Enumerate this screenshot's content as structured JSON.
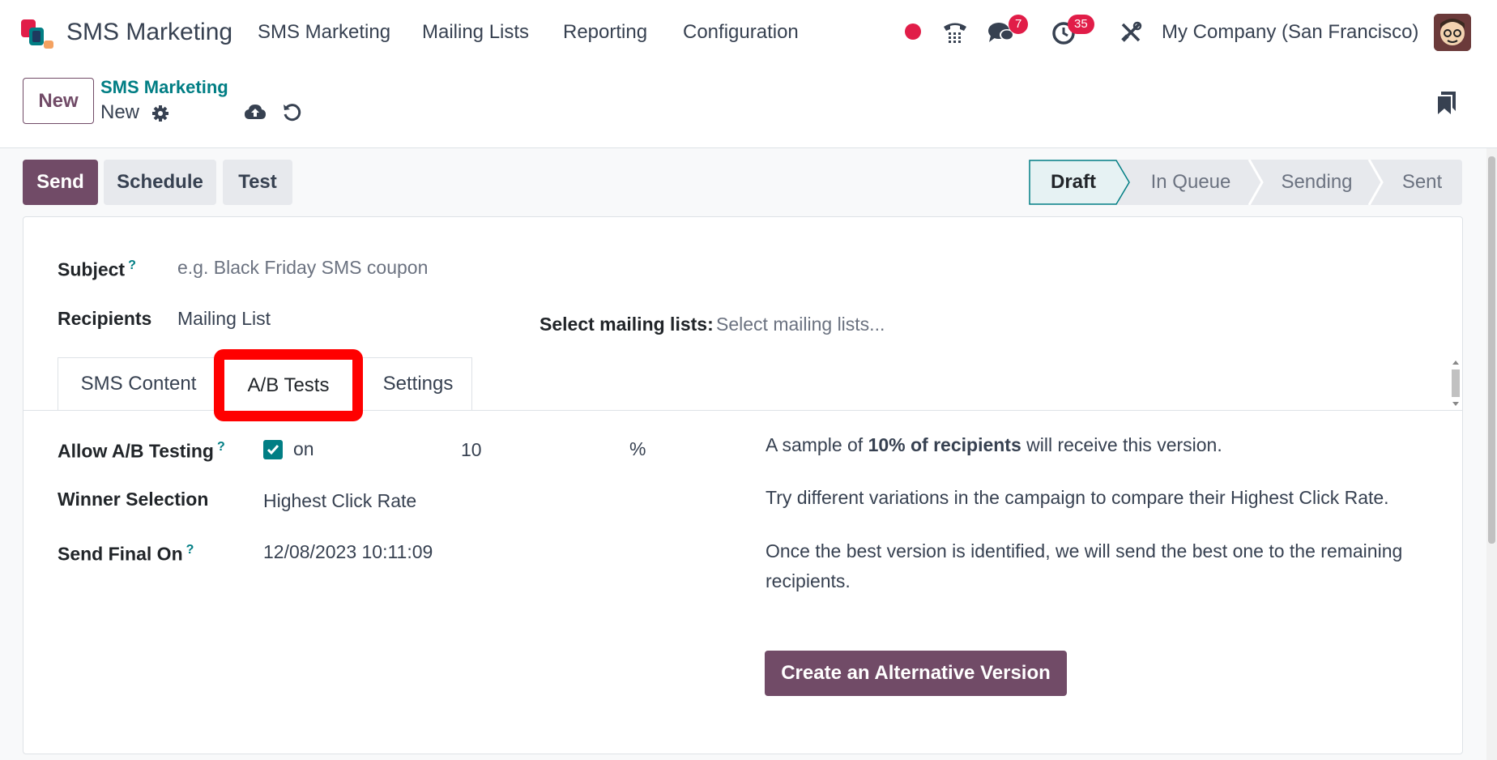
{
  "navbar": {
    "app_name": "SMS Marketing",
    "menu": [
      "SMS Marketing",
      "Mailing Lists",
      "Reporting",
      "Configuration"
    ],
    "messages_badge": "7",
    "activities_badge": "35",
    "company": "My Company (San Francisco)"
  },
  "controlbar": {
    "new_label": "New",
    "breadcrumb_parent": "SMS Marketing",
    "breadcrumb_current": "New"
  },
  "actions": {
    "send": "Send",
    "schedule": "Schedule",
    "test": "Test"
  },
  "status": {
    "stages": [
      "Draft",
      "In Queue",
      "Sending",
      "Sent"
    ],
    "active": "Draft"
  },
  "form": {
    "subject_label": "Subject",
    "subject_placeholder": "e.g. Black Friday SMS coupon",
    "recipients_label": "Recipients",
    "recipients_value": "Mailing List",
    "mailing_lists_label": "Select mailing lists:",
    "mailing_lists_placeholder": "Select mailing lists..."
  },
  "tabs": [
    "SMS Content",
    "A/B Tests",
    "Settings"
  ],
  "ab": {
    "allow_label": "Allow A/B Testing",
    "allow_value": "on",
    "percent_value": "10",
    "percent_sign": "%",
    "winner_label": "Winner Selection",
    "winner_value": "Highest Click Rate",
    "send_final_label": "Send Final On",
    "send_final_value": "12/08/2023 10:11:09",
    "desc1_pre": "A sample of ",
    "desc1_bold": "10% of recipients",
    "desc1_post": " will receive this version.",
    "desc2": "Try different variations in the campaign to compare their Highest Click Rate.",
    "desc3": "Once the best version is identified, we will send the best one to the remaining recipients.",
    "create_alt": "Create an Alternative Version"
  },
  "colors": {
    "primary": "#714b67",
    "teal": "#017e84",
    "badge": "#e11d48",
    "highlight": "#ff0000"
  }
}
